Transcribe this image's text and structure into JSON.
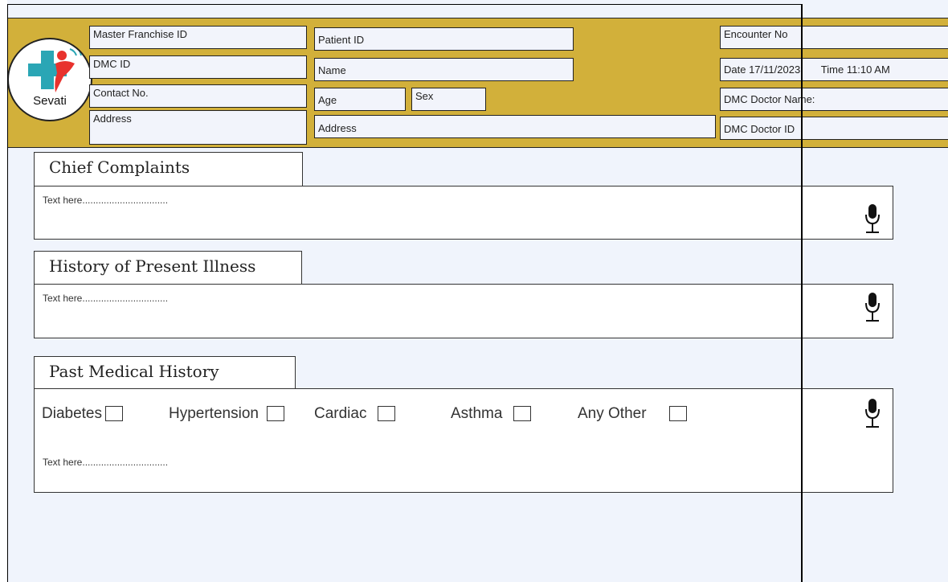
{
  "header": {
    "logo_text": "Sevati",
    "master_franchise_label": "Master Franchise ID",
    "dmc_id_label": "DMC ID",
    "contact_label": "Contact No.",
    "address_left_label": "Address",
    "patient_id_label": "Patient ID",
    "name_label": "Name",
    "age_label": "Age",
    "sex_label": "Sex",
    "address_mid_label": "Address",
    "encounter_label": "Encounter No",
    "date_label": "Date 17/11/2023",
    "time_label": "Time 11:10 AM",
    "doctor_name_label": "DMC Doctor Name:",
    "doctor_id_label": "DMC Doctor ID"
  },
  "sections": {
    "chief": {
      "title": "Chief Complaints",
      "placeholder": "Text here................................"
    },
    "hpi": {
      "title": "History of Present Illness",
      "placeholder": "Text here................................"
    },
    "pmh": {
      "title": "Past Medical History",
      "placeholder": "Text here................................",
      "options": [
        "Diabetes",
        "Hypertension",
        "Cardiac",
        "Asthma",
        "Any Other"
      ]
    }
  },
  "icons": {
    "mic": "microphone-icon",
    "logo": "sevati-logo"
  },
  "colors": {
    "header_bg": "#d2b03a",
    "page_bg": "#f0f4fc",
    "logo_red": "#e8322d",
    "logo_teal": "#2aa6b5"
  }
}
